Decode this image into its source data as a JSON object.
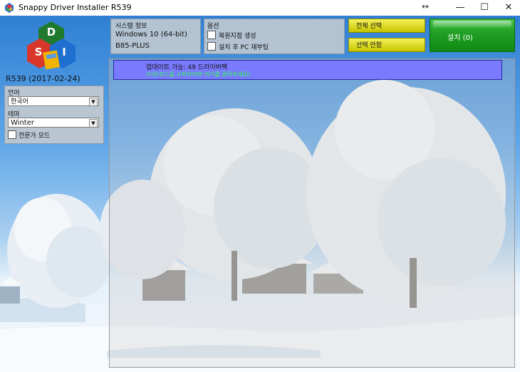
{
  "window": {
    "title": "Snappy Driver Installer R539",
    "controls": {
      "resize": "↔",
      "minimize": "—",
      "maximize": "☐",
      "close": "✕"
    }
  },
  "sidebar": {
    "logo_letters": [
      "D",
      "S",
      "I"
    ],
    "version": "R539 (2017-02-24)",
    "language_label": "언어",
    "language_value": "한국어",
    "theme_label": "테마",
    "theme_value": "Winter",
    "expert_mode_label": "전문가 모드",
    "expert_mode_checked": false
  },
  "sysinfo": {
    "header": "시스템 정보",
    "os": "Windows 10 (64-bit)",
    "board": "B85-PLUS"
  },
  "options": {
    "header": "옵션",
    "restore_point_label": "복원지점 생성",
    "restore_point_checked": false,
    "reboot_label": "설치 후 PC 재부팅",
    "reboot_checked": false
  },
  "actions": {
    "select_all": "전체 선택",
    "select_none": "선택 안함",
    "install": "설치 (0)"
  },
  "updates": {
    "title": "업데이트 가능: 49 드라이버팩",
    "hint": "(다운로드를 시작하려면 여기를 클릭하세요)"
  },
  "colors": {
    "update_bar": "#7a7aff",
    "hint_text": "#2cff4a",
    "install_button": "#1a9a1c",
    "action_button": "#e2e024",
    "panel": "#b9c6d2"
  }
}
